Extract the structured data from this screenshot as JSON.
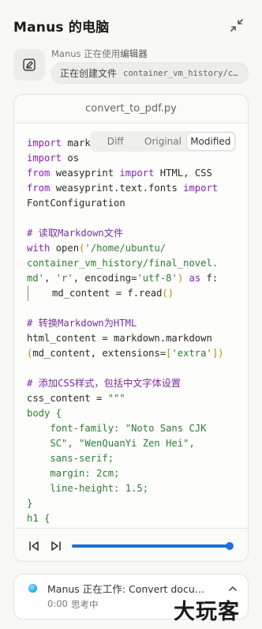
{
  "window": {
    "title": "Manus 的电脑"
  },
  "app": {
    "status_prefix": "Manus 正在使用",
    "app_name": "编辑器",
    "action": "正在创建文件",
    "file_path": "container_vm_history/convert_to_pdf.py"
  },
  "editor": {
    "filename": "convert_to_pdf.py",
    "tabs": [
      {
        "label": "Diff",
        "active": false
      },
      {
        "label": "Original",
        "active": false
      },
      {
        "label": "Modified",
        "active": true
      }
    ],
    "code": {
      "l1_kw": "import",
      "l1_rest": " markdown",
      "l2_kw": "import",
      "l2_rest": " os",
      "l3_kw1": "from",
      "l3_mid": " weasyprint ",
      "l3_kw2": "import",
      "l3_rest": " HTML, CSS",
      "l4_kw1": "from",
      "l4_mid": " weasyprint.text.fonts ",
      "l4_kw2": "import",
      "l5": "FontConfiguration",
      "c1": "# 读取Markdown文件",
      "l7_kw": "with",
      "l7_fn": " open",
      "l7_br": "(",
      "l7_str": "'/home/ubuntu/",
      "l8_str": "container_vm_history/final_novel.",
      "l9_str1": "md'",
      "l9_mid": ", ",
      "l9_str2": "'r'",
      "l9_mid2": ", encoding=",
      "l9_str3": "'utf-8'",
      "l9_br": ")",
      "l9_kw": " as",
      "l9_rest": " f:",
      "l10_pre": "md_content = f.read",
      "l10_br": "()",
      "c2": "# 转换Markdown为HTML",
      "l12": "html_content = markdown.markdown",
      "l13_br1": "(",
      "l13_mid": "md_content, extensions=",
      "l13_br2": "[",
      "l13_str": "'extra'",
      "l13_br3": "])",
      "c3": "# 添加CSS样式，包括中文字体设置",
      "l15_pre": "css_content = ",
      "l15_str": "\"\"\"",
      "l16": "body {",
      "l17": "    font-family: \"Noto Sans CJK",
      "l18": "    SC\", \"WenQuanYi Zen Hei\",",
      "l19": "    sans-serif;",
      "l20": "    margin: 2cm;",
      "l21": "    line-height: 1.5;",
      "l22": "}",
      "l23": "h1 {"
    }
  },
  "player": {
    "progress": 1.0
  },
  "status": {
    "text": "Manus 正在工作: Convert document to PDF",
    "time": "0:00",
    "thinking": "思考中"
  },
  "watermark": {
    "text": "大玩客"
  },
  "colors": {
    "accent": "#1e6fd8",
    "keyword": "#8a1fb0",
    "string": "#2e7d32",
    "bracket": "#c48a00"
  }
}
